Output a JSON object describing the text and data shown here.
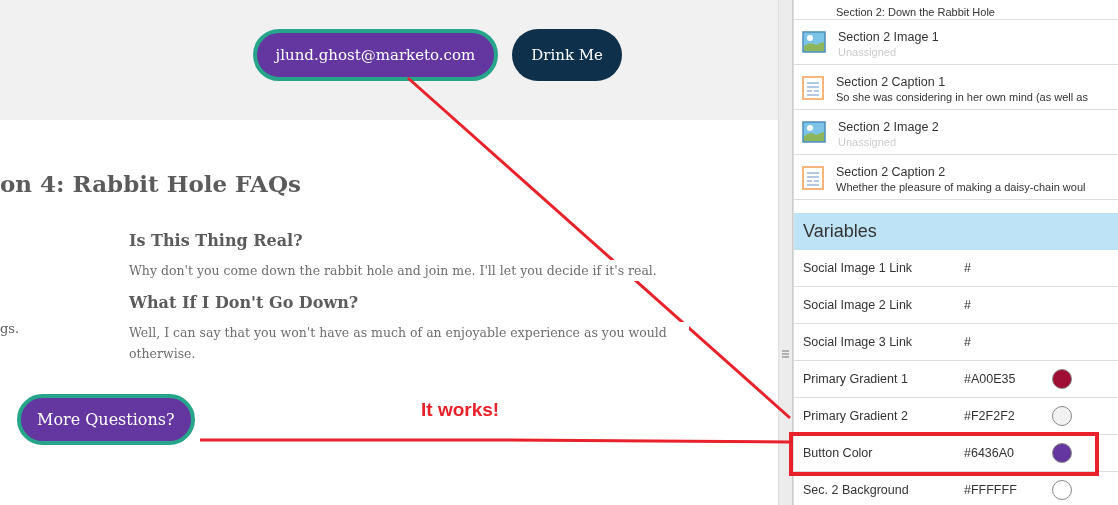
{
  "page": {
    "header_buttons": [
      {
        "label": "jlund.ghost@marketo.com",
        "kind": "outlined"
      },
      {
        "label": "Drink Me",
        "kind": "dark"
      }
    ],
    "section_heading": "on 4: Rabbit Hole FAQs",
    "left_fragment": "gs.",
    "faqs": [
      {
        "question": "Is This Thing Real?",
        "answer": "Why don't you come down the rabbit hole and join me. I'll let you decide if it's real."
      },
      {
        "question": "What If I Don't Go Down?",
        "answer": "Well, I can say that you won't have as much of an enjoyable experience as you would otherwise."
      }
    ],
    "cta_button": "More Questions?"
  },
  "elements_panel": {
    "top_item_text": "Section 2: Down the Rabbit Hole",
    "items": [
      {
        "kind": "image",
        "title": "Section 2 Image 1",
        "subtitle": "Unassigned"
      },
      {
        "kind": "text",
        "title": "Section 2 Caption 1",
        "subtitle": "So she was considering in her own mind (as well as"
      },
      {
        "kind": "image",
        "title": "Section 2 Image 2",
        "subtitle": "Unassigned"
      },
      {
        "kind": "text",
        "title": "Section 2 Caption 2",
        "subtitle": "Whether the pleasure of making a daisy-chain woul"
      }
    ]
  },
  "variables": {
    "title": "Variables",
    "rows": [
      {
        "name": "Social Image 1 Link",
        "value": "#",
        "outlined": false
      },
      {
        "name": "Social Image 2 Link",
        "value": "#",
        "outlined": false
      },
      {
        "name": "Social Image 3 Link",
        "value": "#",
        "outlined": false
      },
      {
        "name": "Primary Gradient 1",
        "value": "#A00E35",
        "color": "#a00e35",
        "outlined": false
      },
      {
        "name": "Primary Gradient 2",
        "value": "#F2F2F2",
        "color": "#f2f2f2",
        "outlined": false
      },
      {
        "name": "Button Color",
        "value": "#6436A0",
        "color": "#6436a0",
        "outlined": true
      },
      {
        "name": "Sec. 2 Background",
        "value": "#FFFFFF",
        "color": "#ffffff",
        "outlined": false
      }
    ]
  },
  "annotation": {
    "text": "It works!"
  }
}
